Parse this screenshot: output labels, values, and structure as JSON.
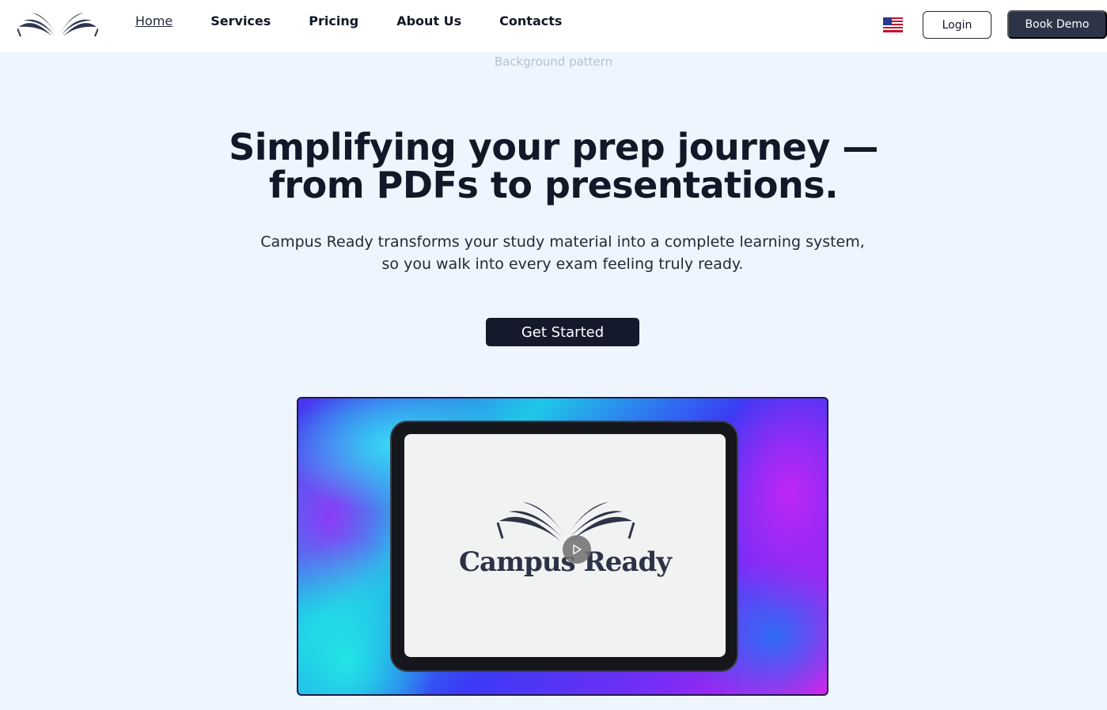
{
  "nav": {
    "links": [
      "Home",
      "Services",
      "Pricing",
      "About Us",
      "Contacts"
    ],
    "login_label": "Login",
    "demo_label": "Book Demo",
    "language_flag": "us-flag-icon"
  },
  "hero": {
    "background_alt": "Background pattern",
    "headline_line1": "Simplifying your prep journey —",
    "headline_line2": "from PDFs to presentations.",
    "subtext_line1": "Campus Ready transforms your study material into a complete learning system,",
    "subtext_line2": "so you walk into every exam feeling truly ready.",
    "cta_label": "Get Started"
  },
  "video": {
    "brand_text": "Campus Ready",
    "play_icon": "play-icon"
  },
  "colors": {
    "primary_dark": "#141a2b",
    "button_dark": "#2d3448",
    "page_bg": "#eef5fe"
  }
}
